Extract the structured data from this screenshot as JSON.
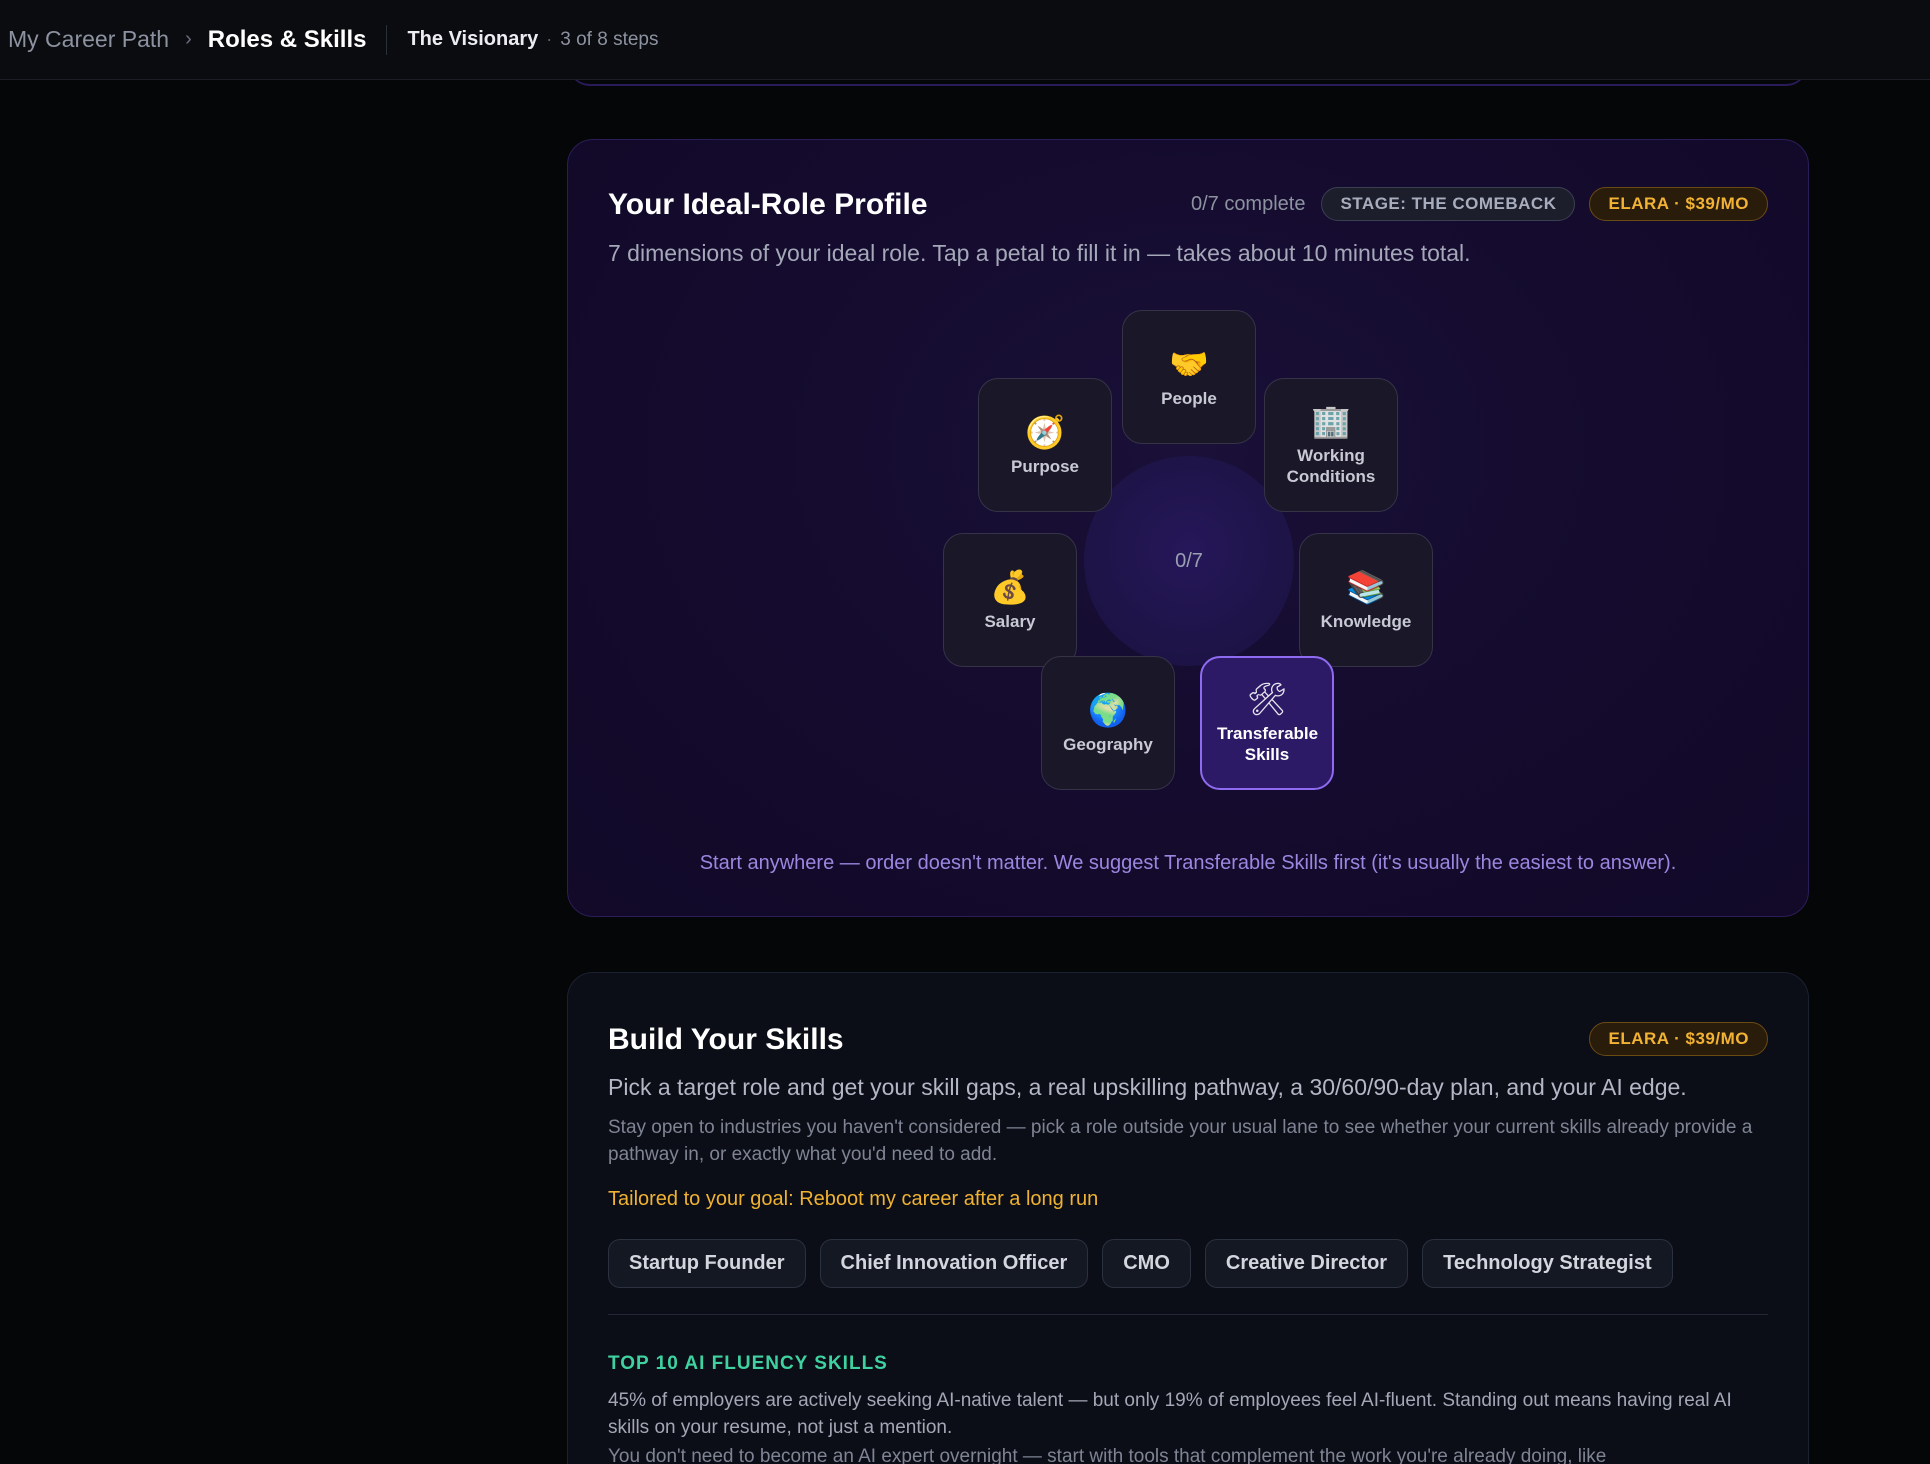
{
  "topbar": {
    "root_crumb": "My Career Path",
    "separator": "›",
    "current_crumb": "Roles & Skills",
    "stage_name": "The Visionary",
    "dot": "·",
    "steps": "3 of 8 steps"
  },
  "profile": {
    "title": "Your Ideal-Role Profile",
    "complete": "0/7 complete",
    "stage_pill": "STAGE: THE COMEBACK",
    "elara_pill": "ELARA · $39/MO",
    "subtitle": "7 dimensions of your ideal role. Tap a petal to fill it in — takes about 10 minutes total.",
    "center_count": "0/7",
    "petals": [
      {
        "label": "People",
        "icon": "🤝",
        "icon_name": "handshake-icon"
      },
      {
        "label": "Purpose",
        "icon": "🧭",
        "icon_name": "compass-icon"
      },
      {
        "label": "Working Conditions",
        "icon": "🏢",
        "icon_name": "office-building-icon"
      },
      {
        "label": "Salary",
        "icon": "💰",
        "icon_name": "money-bag-icon"
      },
      {
        "label": "Knowledge",
        "icon": "📚",
        "icon_name": "books-icon"
      },
      {
        "label": "Geography",
        "icon": "🌍",
        "icon_name": "globe-icon"
      },
      {
        "label": "Transferable Skills",
        "icon": "🛠",
        "icon_name": "tools-icon"
      }
    ],
    "hint": "Start anywhere — order doesn't matter. We suggest Transferable Skills first (it's usually the easiest to answer)."
  },
  "skills": {
    "title": "Build Your Skills",
    "elara_pill": "ELARA · $39/MO",
    "lead": "Pick a target role and get your skill gaps, a real upskilling pathway, a 30/60/90-day plan, and your AI edge.",
    "paragraph": "Stay open to industries you haven't considered — pick a role outside your usual lane to see whether your current skills already provide a pathway in, or exactly what you'd need to add.",
    "goal": "Tailored to your goal: Reboot my career after a long run",
    "roles": [
      "Startup Founder",
      "Chief Innovation Officer",
      "CMO",
      "Creative Director",
      "Technology Strategist"
    ],
    "fluency_heading": "TOP 10 AI FLUENCY SKILLS",
    "fluency_text": "45% of employers are actively seeking AI-native talent — but only 19% of employees feel AI-fluent. Standing out means having real AI skills on your resume, not just a mention.",
    "fluency_text2": "You don't need to become an AI expert overnight — start with tools that complement the work you're already doing, like"
  }
}
